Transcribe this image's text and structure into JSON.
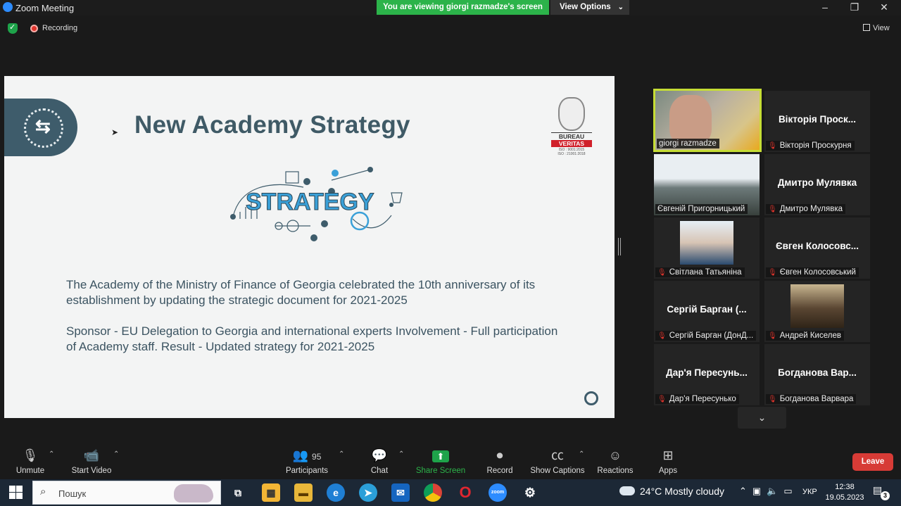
{
  "window": {
    "title": "Zoom Meeting",
    "minimize": "–",
    "restore": "❐",
    "close": "✕"
  },
  "banner": {
    "viewing": "You are viewing giorgi razmadze's screen",
    "view_options": "View Options",
    "chevron": "⌄"
  },
  "status": {
    "recording": "Recording",
    "view": "View"
  },
  "slide": {
    "title": "New Academy Strategy",
    "logo_text": [
      "BUREAU",
      "VERITAS"
    ],
    "iso_lines": [
      "ISO : 9001:2015",
      "ISO : 21001:2018"
    ],
    "graphic_word": "STRATEGY",
    "para1": "The Academy of the Ministry of Finance of Georgia celebrated the 10th anniversary of its establishment by updating the strategic document for 2021-2025",
    "para2": "Sponsor - EU Delegation to Georgia and international experts Involvement - Full participation of Academy staff. Result - Updated strategy for 2021-2025"
  },
  "participants": [
    {
      "display": "",
      "label": "giorgi razmadze",
      "muted": false,
      "video": true,
      "active": true
    },
    {
      "display": "Вікторія Проск...",
      "label": "Вікторія Проскурня",
      "muted": true,
      "video": false
    },
    {
      "display": "",
      "label": "Євгеній Пригорницький",
      "muted": false,
      "video": true
    },
    {
      "display": "Дмитро Мулявка",
      "label": "Дмитро Мулявка",
      "muted": true,
      "video": false
    },
    {
      "display": "",
      "label": "Світлана Татьяніна",
      "muted": true,
      "video": true
    },
    {
      "display": "Євген Колосовс...",
      "label": "Євген Колосовський",
      "muted": true,
      "video": false
    },
    {
      "display": "Сергій Барган (...",
      "label": "Сергій Барган (ДонД...",
      "muted": true,
      "video": false
    },
    {
      "display": "",
      "label": "Андрей Киселев",
      "muted": true,
      "video": true
    },
    {
      "display": "Дар'я Пересунь...",
      "label": "Дар'я Пересунько",
      "muted": true,
      "video": false
    },
    {
      "display": "Богданова Вар...",
      "label": "Богданова Варвара",
      "muted": true,
      "video": false
    }
  ],
  "toolbar": {
    "unmute": "Unmute",
    "start_video": "Start Video",
    "participants": "Participants",
    "participants_count": "95",
    "chat": "Chat",
    "share_screen": "Share Screen",
    "record": "Record",
    "show_captions": "Show Captions",
    "reactions": "Reactions",
    "apps": "Apps",
    "leave": "Leave"
  },
  "taskbar": {
    "search_placeholder": "Пошук",
    "weather": "24°C  Mostly cloudy",
    "lang": "УКР",
    "time": "12:38",
    "date": "19.05.2023",
    "notifications": "3"
  },
  "colors": {
    "accent_green": "#2cb34a",
    "leave_red": "#d73b36",
    "active_speaker": "#c6dd35",
    "slide_text": "#3b5361"
  }
}
